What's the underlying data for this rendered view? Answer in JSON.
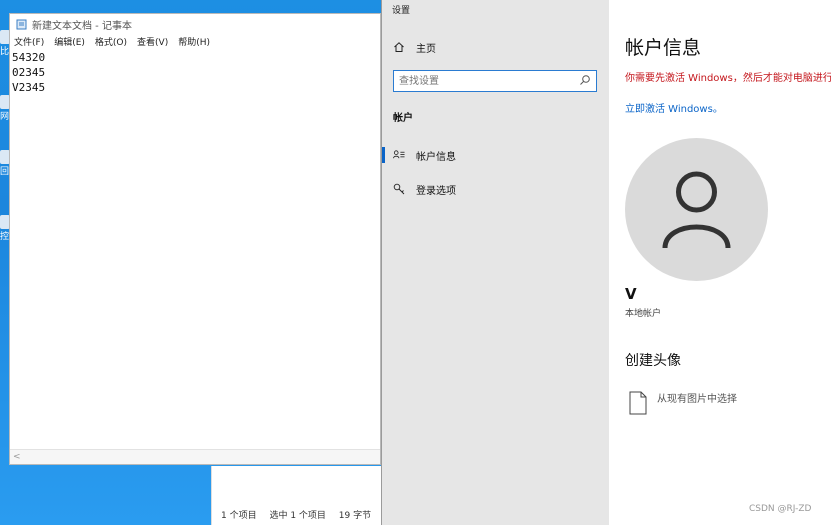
{
  "desktop": {
    "icons": [
      "比",
      "网",
      "回",
      "控"
    ]
  },
  "notepad": {
    "title": "新建文本文档 - 记事本",
    "menu": [
      "文件(F)",
      "编辑(E)",
      "格式(O)",
      "查看(V)",
      "帮助(H)"
    ],
    "lines": [
      "54320",
      "02345",
      "V2345"
    ],
    "scroll_left_glyph": "<"
  },
  "explorer": {
    "status": {
      "items": "1 个项目",
      "selected": "选中 1 个项目",
      "size": "19 字节"
    }
  },
  "settings": {
    "window_title": "设置",
    "nav": {
      "home_label": "主页",
      "search_placeholder": "查找设置",
      "section_title": "帐户",
      "items": [
        {
          "label": "帐户信息",
          "icon": "person-list-icon",
          "active": true
        },
        {
          "label": "登录选项",
          "icon": "key-icon",
          "active": false
        }
      ]
    },
    "main": {
      "title": "帐户信息",
      "activation_warning": "你需要先激活 Windows，然后才能对电脑进行个",
      "activation_link": "立即激活 Windows。",
      "user_name": "V",
      "account_type": "本地帐户",
      "create_avatar_heading": "创建头像",
      "browse_label": "从现有图片中选择",
      "watermark": "CSDN @RJ-ZD"
    },
    "colors": {
      "accent": "#0a64c8",
      "warning": "#c4161c",
      "nav_bg": "#e6e6e6",
      "avatar_bg": "#dadada"
    }
  }
}
